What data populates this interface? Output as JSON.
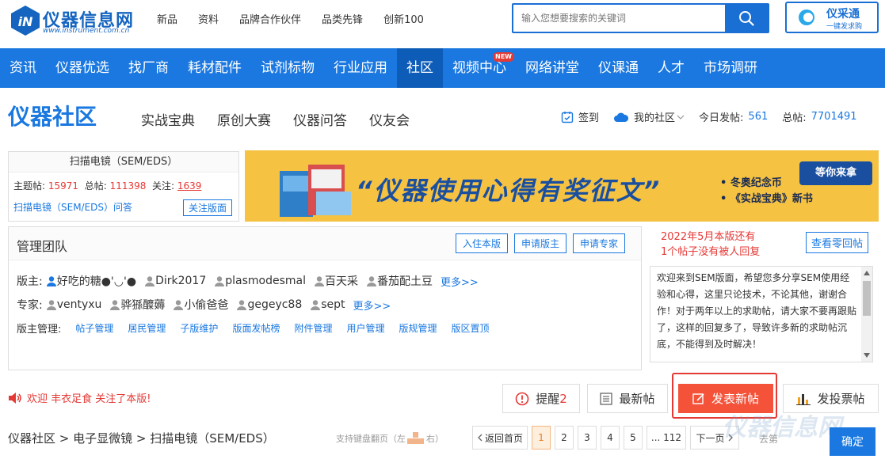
{
  "header": {
    "logo_text": "仪器信息网",
    "logo_url": "www.instrument.com.cn",
    "top_links": [
      "新品",
      "资料",
      "品牌合作伙伴",
      "品类先锋",
      "创新100"
    ],
    "search_placeholder": "输入您想要搜索的关键词",
    "ycb_title": "仪采通",
    "ycb_sub": "一键发求购"
  },
  "main_nav": {
    "items": [
      "资讯",
      "仪器优选",
      "找厂商",
      "耗材配件",
      "试剂标物",
      "行业应用",
      "社区",
      "视频中心",
      "网络讲堂",
      "仪课通",
      "人才",
      "市场调研"
    ],
    "active": "社区",
    "new_badge": "NEW"
  },
  "community": {
    "title": "仪器社区",
    "sub_nav": [
      "实战宝典",
      "原创大赛",
      "仪器问答",
      "仪友会"
    ],
    "checkin": "签到",
    "my_community": "我的社区",
    "today_label": "今日发帖:",
    "today_value": "561",
    "total_label": "总帖:",
    "total_value": "7701491"
  },
  "board": {
    "name": "扫描电镜（SEM/EDS）",
    "topics_label": "主题帖:",
    "topics": "15971",
    "posts_label": "总帖:",
    "posts": "111398",
    "follow_label": "关注:",
    "follows": "1639",
    "qa_link": "扫描电镜（SEM/EDS）问答",
    "follow_button": "关注版面"
  },
  "banner": {
    "title": "“仪器使用心得有奖征文”",
    "line1": "• 冬奥纪念币",
    "line2": "• 《实战宝典》新书",
    "tag": "等你来拿"
  },
  "management": {
    "title": "管理团队",
    "buttons": [
      "入住本版",
      "申请版主",
      "申请专家"
    ],
    "moderator_label": "版主:",
    "moderators": [
      "好吃的糖●'◡'●",
      "Dirk2017",
      "plasmodesmal",
      "百天采",
      "番茄配土豆"
    ],
    "expert_label": "专家:",
    "experts": [
      "ventyxu",
      "骅猻醾薅",
      "小偷爸爸",
      "gegeyc88",
      "sept"
    ],
    "more": "更多>>",
    "admin_label": "版主管理:",
    "admin_links": [
      "帖子管理",
      "居民管理",
      "子版维护",
      "版面发帖榜",
      "附件管理",
      "用户管理",
      "版规管理",
      "版区置顶"
    ]
  },
  "side": {
    "zero_line1": "2022年5月本版还有",
    "zero_line2": "1个帖子没有被人回复",
    "zero_button": "查看零回帖",
    "notice": "欢迎来到SEM版面，希望您多分享SEM使用经验和心得，这里只论技术，不论其他，谢谢合作！对于两年以上的求助帖，请大家不要再跟贴了，这样的回复多了，导致许多新的求助帖沉底，不能得到及时解决！"
  },
  "actions": {
    "welcome": "欢迎 丰衣足食 关注了本版!",
    "remind": "提醒",
    "remind_count": "2",
    "latest": "最新帖",
    "post": "发表新帖",
    "vote": "发投票帖"
  },
  "footer": {
    "breadcrumb": "仪器社区 > 电子显微镜 > 扫描电镜（SEM/EDS）",
    "kbd_hint_pre": "支持键盘翻页（左",
    "kbd_hint_post": "右）",
    "first_page": "返回首页",
    "pages": [
      "1",
      "2",
      "3",
      "4",
      "5",
      "... 112"
    ],
    "next": "下一页",
    "goto": "去第",
    "confirm": "确定",
    "watermark": "仪器信息网"
  },
  "colors": {
    "brand": "#1a78e0",
    "accent_red": "#e53935",
    "post_button": "#f4533a",
    "banner_bg": "#f5c242"
  }
}
